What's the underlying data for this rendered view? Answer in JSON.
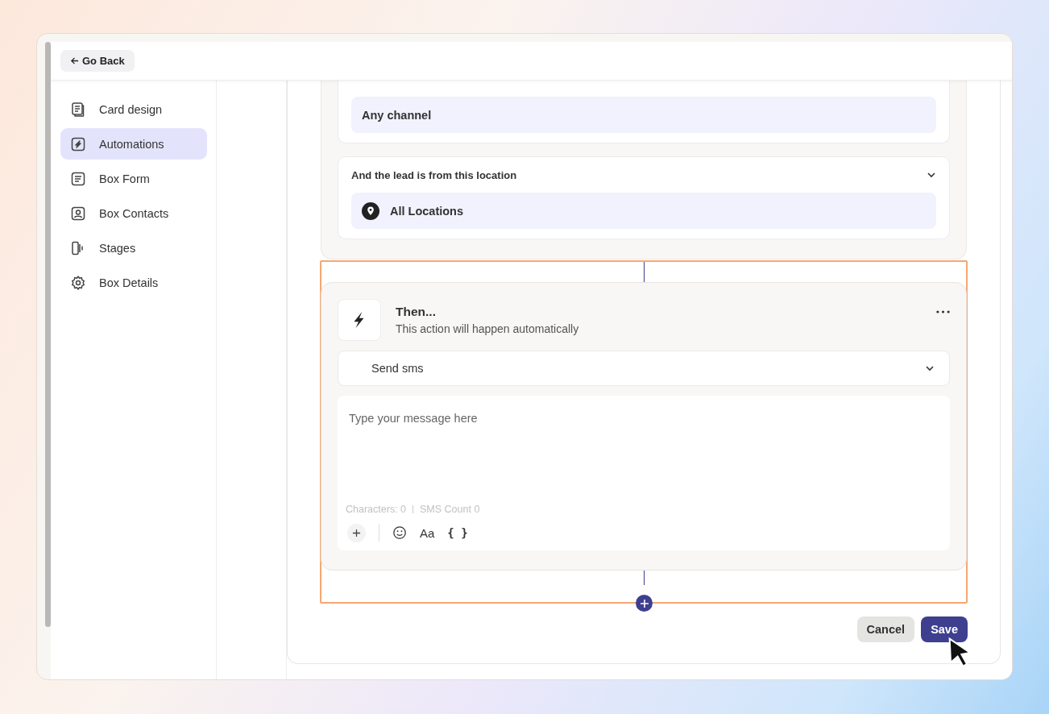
{
  "back_button": {
    "label": "Go Back"
  },
  "sidebar": {
    "items": [
      {
        "label": "Card design",
        "selected": false
      },
      {
        "label": "Automations",
        "selected": true
      },
      {
        "label": "Box Form",
        "selected": false
      },
      {
        "label": "Box Contacts",
        "selected": false
      },
      {
        "label": "Stages",
        "selected": false
      },
      {
        "label": "Box Details",
        "selected": false
      }
    ]
  },
  "conditions": [
    {
      "kind": "plain",
      "value": "Any channel"
    },
    {
      "kind": "location",
      "title": "And the lead is from this location",
      "value": "All Locations"
    }
  ],
  "action": {
    "title": "Then...",
    "subtitle": "This action will happen automatically",
    "select": "Send sms",
    "message_placeholder": "Type your message here",
    "characters": "Characters: 0",
    "sms_count": "SMS Count 0",
    "format_label": "Aa",
    "variables_label": "{ }"
  },
  "buttons": {
    "cancel": "Cancel",
    "save": "Save"
  }
}
